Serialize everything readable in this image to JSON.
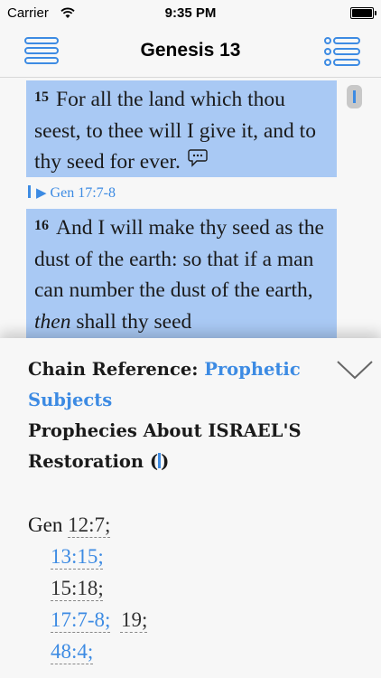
{
  "status": {
    "carrier": "Carrier",
    "time": "9:35 PM"
  },
  "nav": {
    "title": "Genesis 13"
  },
  "verses": [
    {
      "num": "15",
      "text": "For all the land which thou seest, to thee will I give it, and to thy seed for ever."
    },
    {
      "num": "16",
      "text_a": "And I will make thy seed as the dust of the earth: so that if a man can number the dust of the earth, ",
      "text_italic": "then",
      "text_b": " shall thy seed"
    }
  ],
  "crossref": {
    "label": "Gen 17:7-8"
  },
  "panel": {
    "header_label": "Chain Reference: ",
    "header_link": "Prophetic Subjects",
    "subtitle_a": "Prophecies About ISRAEL'S Restoration (",
    "subtitle_b": ")",
    "book": "Gen",
    "refs": {
      "r1": "12:7;",
      "r2": "13:15;",
      "r3": "15:18;",
      "r4": "17:7-8;",
      "r5": "19;",
      "r6": "48:4;"
    }
  },
  "colors": {
    "accent": "#3d8be3",
    "highlight": "#a9c9f4"
  }
}
